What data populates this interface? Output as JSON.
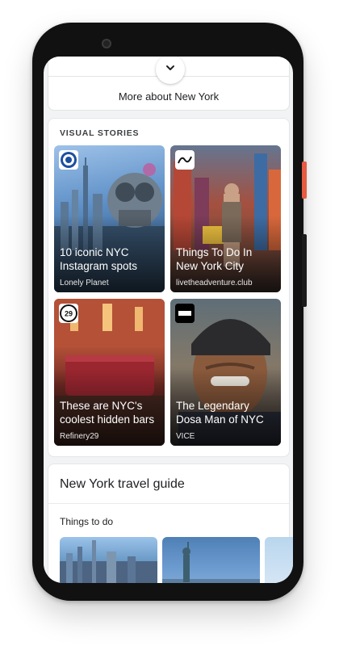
{
  "more_about": {
    "label": "More about New York"
  },
  "visual_stories": {
    "section_title": "VISUAL STORIES",
    "stories": [
      {
        "headline": "10 iconic NYC Instagram spots",
        "source": "Lonely Planet",
        "logo_text": "lonely planet"
      },
      {
        "headline": "Things To Do In New York City",
        "source": "livetheadventure.club",
        "logo_text": "Live The Adventure"
      },
      {
        "headline": "These are NYC's coolest hidden bars",
        "source": "Refinery29",
        "logo_text": "29"
      },
      {
        "headline": "The Legendary Dosa Man of NYC",
        "source": "VICE",
        "logo_text": "VICE"
      }
    ]
  },
  "travel_guide": {
    "title": "New York travel guide",
    "subtitle": "Things to do"
  },
  "colors": {
    "accent_side_button": "#e65b41",
    "background": "#f1f3f4",
    "card": "#ffffff"
  },
  "icons": {
    "expand": "chevron-down-icon"
  }
}
